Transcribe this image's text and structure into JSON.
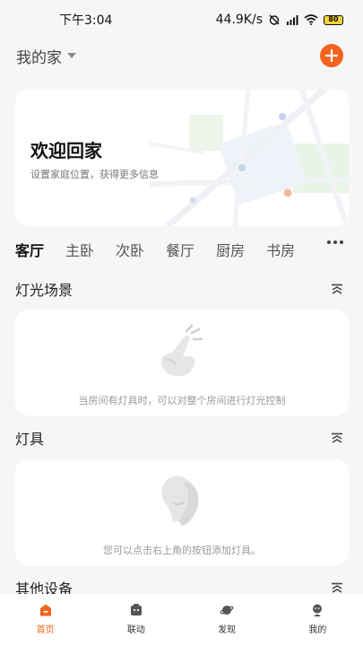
{
  "status_bar": {
    "time": "下午3:04",
    "net_speed": "44.9K/s",
    "battery": "80"
  },
  "header": {
    "home_name": "我的家"
  },
  "welcome": {
    "title": "欢迎回家",
    "subtitle": "设置家庭位置，获得更多信息"
  },
  "rooms": [
    "客厅",
    "主卧",
    "次卧",
    "餐厅",
    "厨房",
    "书房"
  ],
  "sections": {
    "scenes": {
      "title": "灯光场景",
      "empty_text": "当房间有灯具时，可以对整个房间进行灯光控制"
    },
    "lights": {
      "title": "灯具",
      "empty_text": "您可以点击右上角的按钮添加灯具。"
    },
    "others": {
      "title": "其他设备"
    }
  },
  "tabs": [
    {
      "label": "首页",
      "icon": "home-icon",
      "active": true
    },
    {
      "label": "联动",
      "icon": "automation-icon",
      "active": false
    },
    {
      "label": "发现",
      "icon": "discover-planet-icon",
      "active": false
    },
    {
      "label": "我的",
      "icon": "profile-icon",
      "active": false
    }
  ],
  "colors": {
    "accent": "#f4631f",
    "background": "#f6f6f6",
    "card": "#ffffff"
  }
}
